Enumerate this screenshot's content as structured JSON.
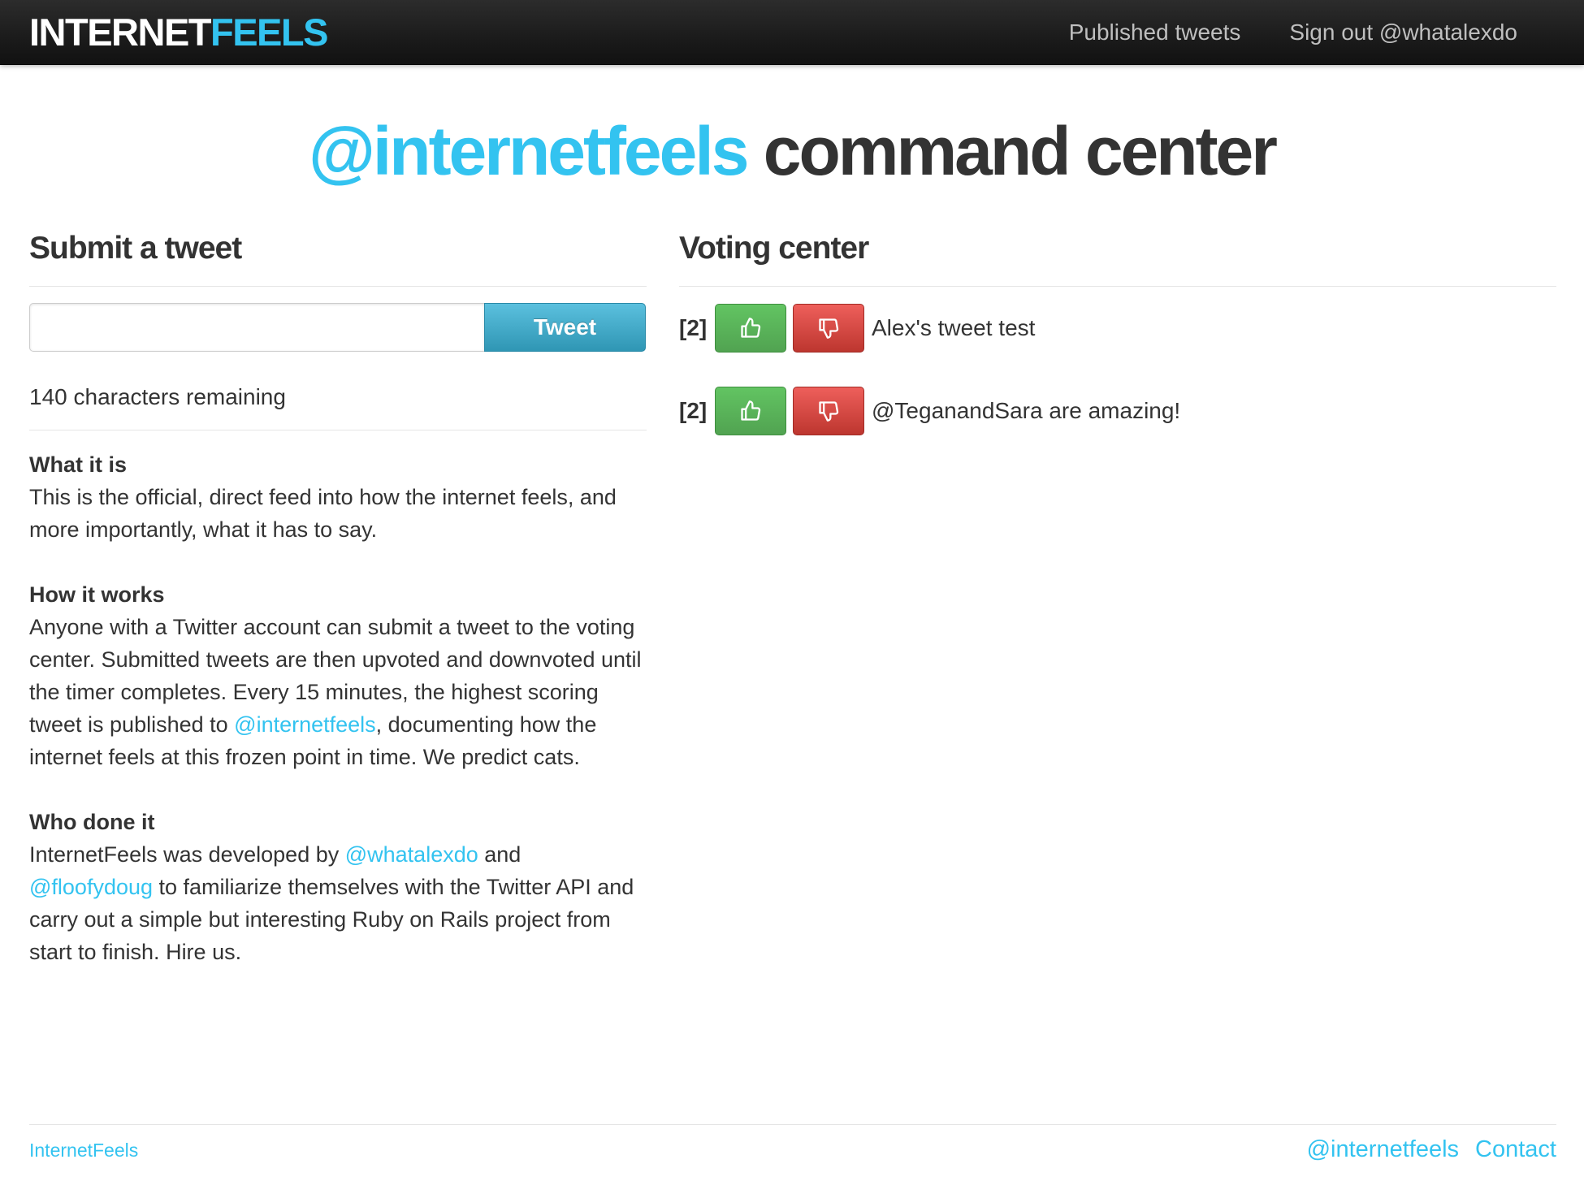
{
  "navbar": {
    "brand_main": "INTERNET",
    "brand_accent": "FEELS",
    "links": {
      "published": "Published tweets",
      "signout": "Sign out @whatalexdo"
    }
  },
  "hero": {
    "handle": "@internetfeels",
    "rest": " command center"
  },
  "submit": {
    "title": "Submit a tweet",
    "input_value": "",
    "button": "Tweet",
    "remaining": "140 characters remaining"
  },
  "about": {
    "what": {
      "title": "What it is",
      "text": "This is the official, direct feed into how the internet feels, and more importantly, what it has to say."
    },
    "how": {
      "title": "How it works",
      "text_1": "Anyone with a Twitter account can submit a tweet to the voting center. Submitted tweets are then upvoted and downvoted until the timer completes. Every 15 minutes, the highest scoring tweet is published to ",
      "link": "@internetfeels",
      "text_2": ", documenting how the internet feels at this frozen point in time. We predict cats."
    },
    "who": {
      "title": "Who done it",
      "text_1": "InternetFeels was developed by ",
      "link_1": "@whatalexdo",
      "text_2": " and ",
      "link_2": "@floofydoug",
      "text_3": " to familiarize themselves with the Twitter API and carry out a simple but interesting Ruby on Rails project from start to finish. Hire us."
    }
  },
  "voting": {
    "title": "Voting center",
    "items": [
      {
        "score": "[2]",
        "text": "Alex's tweet test"
      },
      {
        "score": "[2]",
        "text": "@TeganandSara are amazing!"
      }
    ]
  },
  "footer": {
    "brand": "InternetFeels",
    "link_handle": "@internetfeels",
    "link_contact": "Contact"
  },
  "colors": {
    "accent": "#33c3f0",
    "upvote": "#5bb75b",
    "downvote": "#da4f49",
    "tweet_button": "#49afcd"
  }
}
